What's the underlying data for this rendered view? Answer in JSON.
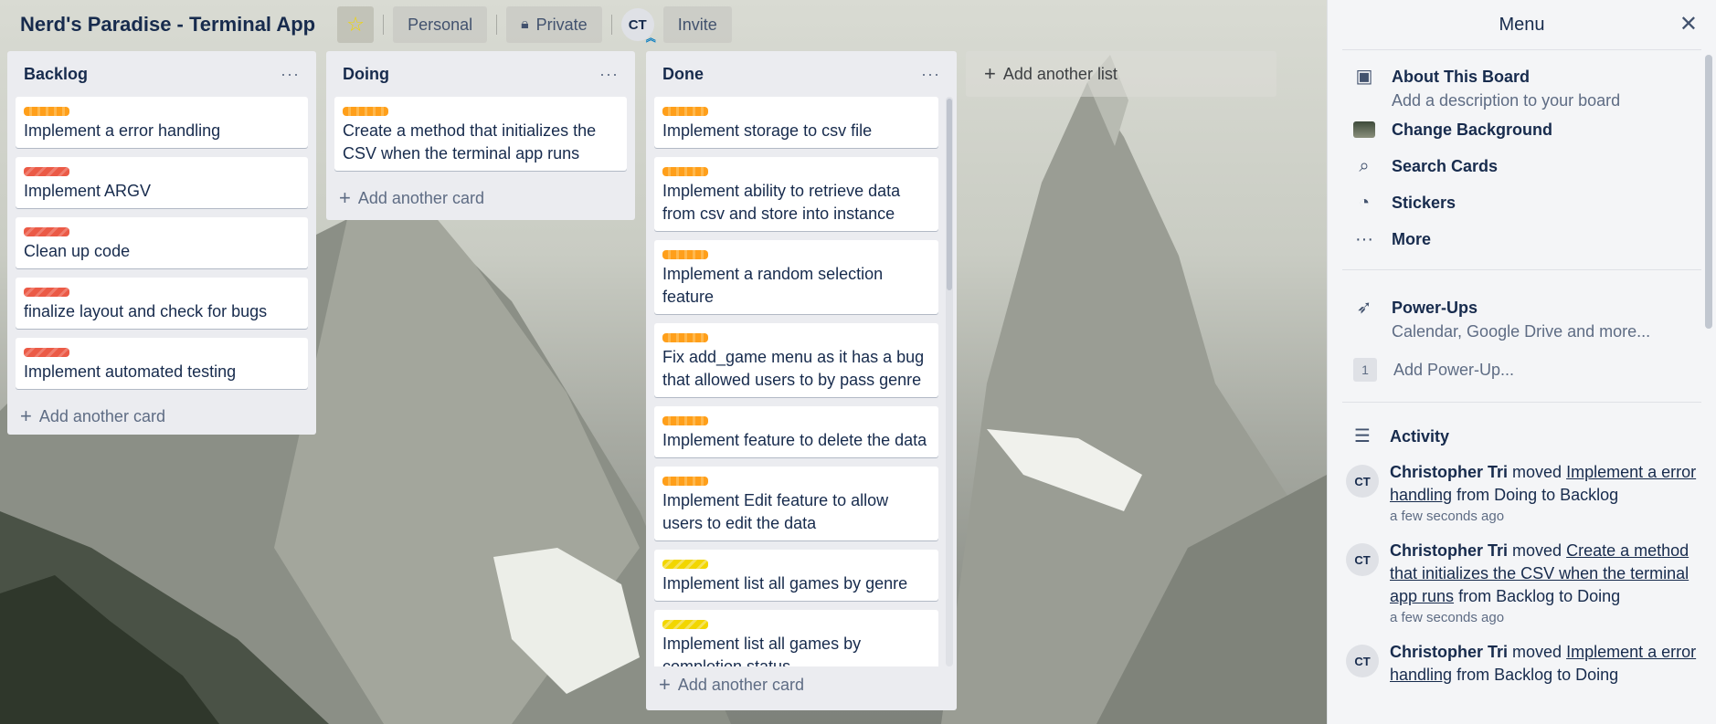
{
  "header": {
    "board_title": "Nerd's Paradise - Terminal App",
    "personal_label": "Personal",
    "private_label": "Private",
    "avatar_initials": "CT",
    "invite_label": "Invite"
  },
  "lists": [
    {
      "title": "Backlog",
      "cards": [
        {
          "label_color": "orange",
          "text": "Implement a error handling"
        },
        {
          "label_color": "red",
          "text": "Implement ARGV"
        },
        {
          "label_color": "red",
          "text": "Clean up code"
        },
        {
          "label_color": "red",
          "text": "finalize layout and check for bugs"
        },
        {
          "label_color": "red",
          "text": "Implement automated testing"
        }
      ],
      "add_card_label": "Add another card"
    },
    {
      "title": "Doing",
      "cards": [
        {
          "label_color": "orange",
          "text": "Create a method that initializes the CSV when the terminal app runs"
        }
      ],
      "add_card_label": "Add another card"
    },
    {
      "title": "Done",
      "cards": [
        {
          "label_color": "orange",
          "text": "Implement storage to csv file"
        },
        {
          "label_color": "orange",
          "text": "Implement ability to retrieve data from csv and store into instance"
        },
        {
          "label_color": "orange",
          "text": "Implement a random selection feature"
        },
        {
          "label_color": "orange",
          "text": "Fix add_game menu as it has a bug that allowed users to by pass genre"
        },
        {
          "label_color": "orange",
          "text": "Implement feature to delete the data"
        },
        {
          "label_color": "orange",
          "text": "Implement Edit feature to allow users to edit the data"
        },
        {
          "label_color": "yellow",
          "text": "Implement list all games by genre"
        },
        {
          "label_color": "yellow",
          "text": "Implement list all games by completion status"
        }
      ],
      "add_card_label": "Add another card"
    }
  ],
  "add_list_label": "Add another list",
  "menu": {
    "title": "Menu",
    "about_title": "About This Board",
    "about_sub": "Add a description to your board",
    "change_background": "Change Background",
    "search_cards": "Search Cards",
    "stickers": "Stickers",
    "more": "More",
    "powerups_title": "Power-Ups",
    "powerups_sub": "Calendar, Google Drive and more...",
    "add_powerup_badge": "1",
    "add_powerup": "Add Power-Up...",
    "activity_title": "Activity",
    "activity": [
      {
        "initials": "CT",
        "user": "Christopher Tri",
        "action": "moved",
        "card": "Implement a error handling",
        "detail": "from Doing to Backlog",
        "time": "a few seconds ago"
      },
      {
        "initials": "CT",
        "user": "Christopher Tri",
        "action": "moved",
        "card": "Create a method that initializes the CSV when the terminal app runs",
        "detail": "from Backlog to Doing",
        "time": "a few seconds ago"
      },
      {
        "initials": "CT",
        "user": "Christopher Tri",
        "action": "moved",
        "card": "Implement a error handling",
        "detail": "from Backlog to Doing",
        "time": ""
      }
    ]
  },
  "colors": {
    "label_orange": "#ff9f1a",
    "label_red": "#eb5a46",
    "label_yellow": "#f2d600",
    "list_bg": "#ebecf0",
    "title_color": "#172b4d"
  }
}
